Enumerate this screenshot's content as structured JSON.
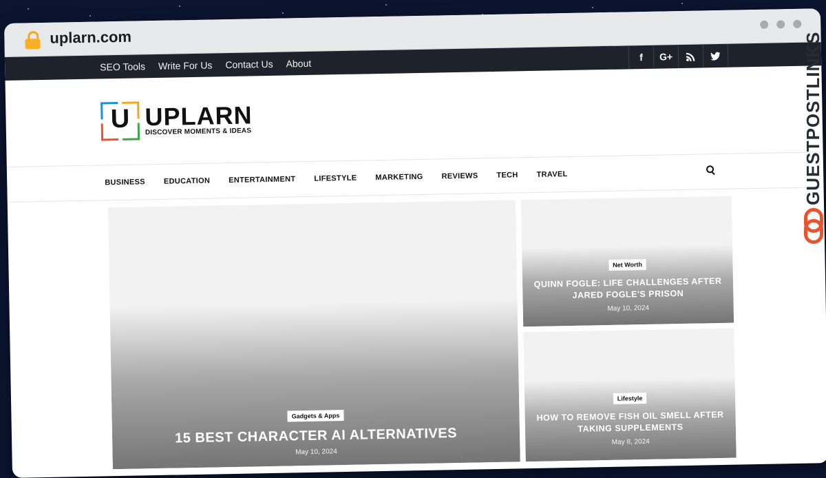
{
  "browser": {
    "url": "uplarn.com"
  },
  "topbar": {
    "links": [
      "SEO Tools",
      "Write For Us",
      "Contact Us",
      "About"
    ],
    "social": [
      {
        "icon": "facebook-icon",
        "glyph": "f"
      },
      {
        "icon": "google-plus-icon",
        "glyph": "G+"
      },
      {
        "icon": "rss-icon",
        "glyph": ""
      },
      {
        "icon": "twitter-icon",
        "glyph": ""
      }
    ]
  },
  "logo": {
    "mark": "U",
    "name": "UPLARN",
    "tagline": "DISCOVER MOMENTS & IDEAS"
  },
  "categories": [
    "BUSINESS",
    "EDUCATION",
    "ENTERTAINMENT",
    "LIFESTYLE",
    "MARKETING",
    "REVIEWS",
    "TECH",
    "TRAVEL"
  ],
  "featured": [
    {
      "category": "Gadgets & Apps",
      "title": "15 BEST CHARACTER AI ALTERNATIVES",
      "date": "May 10, 2024"
    },
    {
      "category": "Net Worth",
      "title": "QUINN FOGLE: LIFE CHALLENGES AFTER JARED FOGLE'S PRISON",
      "date": "May 10, 2024"
    },
    {
      "category": "Lifestyle",
      "title": "HOW TO REMOVE FISH OIL SMELL AFTER TAKING SUPPLEMENTS",
      "date": "May 8, 2024"
    }
  ],
  "side_brand": "GUESTPOSTLINKS"
}
